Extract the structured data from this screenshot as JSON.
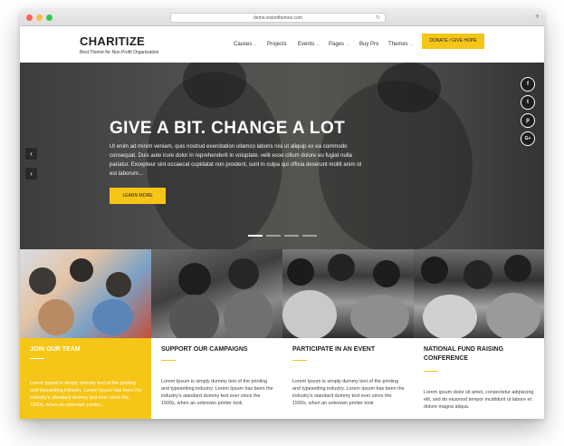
{
  "browser": {
    "url": "demo.visionthemes.com",
    "reload_icon": "↻",
    "new_tab_icon": "+"
  },
  "site": {
    "logo": "CHARITIZE",
    "tagline": "Best Theme for Non Profit Organization"
  },
  "nav": {
    "items": [
      {
        "label": "Causes",
        "dropdown": true
      },
      {
        "label": "Projects",
        "dropdown": false
      },
      {
        "label": "Events",
        "dropdown": true
      },
      {
        "label": "Pages",
        "dropdown": true
      },
      {
        "label": "Buy Pro",
        "dropdown": false
      },
      {
        "label": "Themes",
        "dropdown": true
      }
    ],
    "caret": "⌄",
    "cta": "DONATE / GIVE HOPE"
  },
  "hero": {
    "title": "GIVE A BIT. CHANGE A LOT",
    "text": "Ut enim ad minim veniam, quis nostrud exercitation ullamco laboris nisi ut aliquip ex ea commodo consequat. Duis aute irure dolor in reprehenderit in voluptate. velit esse cillum dolore eu fugiat nulla pariatur. Excepteur sint occaecat cupidatat non proident, sunt in culpa qui officia deserunt mollit anim id est laborum...",
    "button": "LEARN MORE",
    "prev_icon": "‹",
    "next_icon": "›",
    "active_slide": 1,
    "slide_count": 4
  },
  "social": [
    {
      "name": "facebook-icon",
      "glyph": "f"
    },
    {
      "name": "twitter-icon",
      "glyph": "t"
    },
    {
      "name": "pinterest-icon",
      "glyph": "p"
    },
    {
      "name": "google-plus-icon",
      "glyph": "G+"
    }
  ],
  "features": [
    {
      "title": "JOIN OUR TEAM",
      "text": "Lorem Ipsum is simply dummy text of the printing and typesetting industry. Lorem Ipsum has been the industry's standard dummy text ever since the 1500s, when an unknown printer..."
    },
    {
      "title": "SUPPORT OUR CAMPAIGNS",
      "text": "Lorem Ipsum is simply dummy text of the printing and typesetting industry. Lorem Ipsum has been the industry's standard dummy text ever since the 1500s, when an unknown printer took"
    },
    {
      "title": "PARTICIPATE IN AN EVENT",
      "text": "Lorem Ipsum is simply dummy text of the printing and typesetting industry. Lorem Ipsum has been the industry's standard dummy text ever since the 1500s, when an unknown printer took"
    },
    {
      "title": "NATIONAL FUND RAISING CONFERENCE",
      "text": "Lorem ipsum dolor sit amet, consectetur adipiscing elit, sed do eiusmod tempor incididunt ut labore et dolore magna aliqua."
    }
  ],
  "colors": {
    "accent": "#f5c518",
    "dark": "#222222"
  }
}
